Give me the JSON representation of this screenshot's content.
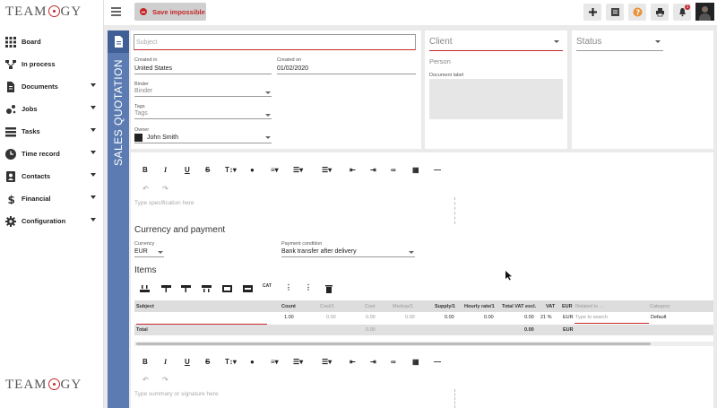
{
  "app": {
    "logo_text": "TeamOGY"
  },
  "sidebar": {
    "items": [
      {
        "label": "Board",
        "icon": "grid-icon",
        "has_submenu": false
      },
      {
        "label": "In process",
        "icon": "process-icon",
        "has_submenu": false
      },
      {
        "label": "Documents",
        "icon": "document-icon",
        "has_submenu": true
      },
      {
        "label": "Jobs",
        "icon": "jobs-icon",
        "has_submenu": true
      },
      {
        "label": "Tasks",
        "icon": "tasks-icon",
        "has_submenu": true
      },
      {
        "label": "Time record",
        "icon": "clock-icon",
        "has_submenu": true
      },
      {
        "label": "Contacts",
        "icon": "contacts-icon",
        "has_submenu": true
      },
      {
        "label": "Financial",
        "icon": "dollar-icon",
        "has_submenu": true
      },
      {
        "label": "Configuration",
        "icon": "gear-icon",
        "has_submenu": true
      }
    ]
  },
  "toolbar": {
    "save_label": "Save impossible",
    "notification_count": "1"
  },
  "document": {
    "type_title": "SALES QUOTATION"
  },
  "form": {
    "subject_placeholder": "Subject",
    "created_in_label": "Created in",
    "created_in_value": "United States",
    "created_on_label": "Created on",
    "created_on_value": "01/02/2020",
    "binder_label": "Binder",
    "binder_placeholder": "Binder",
    "tags_label": "Tags",
    "tags_placeholder": "Tags",
    "owner_label": "Owner",
    "owner_value": "John Smith"
  },
  "client": {
    "label": "Client",
    "person": "Person",
    "document_label": "Document label"
  },
  "status": {
    "label": "Status"
  },
  "editor": {
    "spec_placeholder": "Type specification here",
    "summary_placeholder": "Type summary or signature here"
  },
  "payment": {
    "section_title": "Currency and payment",
    "currency_label": "Currency",
    "currency_value": "EUR",
    "condition_label": "Payment condition",
    "condition_value": "Bank transfer after delivery"
  },
  "items": {
    "section_title": "Items",
    "columns": [
      "Subject",
      "Count",
      "Cost/1",
      "Cost",
      "Markup/1",
      "Supply/1",
      "Hourly rate/1",
      "Total VAT excl.",
      "VAT",
      "EUR",
      "Related to ...",
      "Category"
    ],
    "row": {
      "count": "1.00",
      "cost1": "0.00",
      "cost": "0.00",
      "markup": "0.00",
      "supply": "0.00",
      "hourly": "0.00",
      "total": "0.00",
      "vat": "21 %",
      "currency": "EUR",
      "related_placeholder": "Type to search",
      "category": "Default"
    },
    "total_row": {
      "label": "Total",
      "cost": "0.00",
      "total": "0.00",
      "currency": "EUR"
    }
  }
}
